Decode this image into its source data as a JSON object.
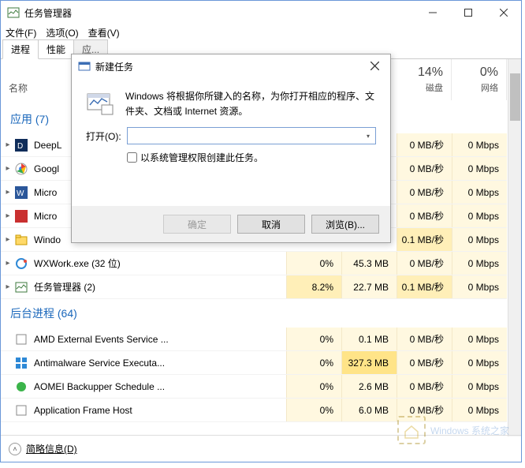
{
  "titlebar": {
    "title": "任务管理器"
  },
  "menubar": {
    "file": "文件(F)",
    "options": "选项(O)",
    "view": "查看(V)"
  },
  "tabs": {
    "t0": "进程",
    "t1": "性能",
    "t2": "应..."
  },
  "columns": {
    "name": "名称",
    "disk_pct": "14%",
    "disk_lbl": "磁盘",
    "net_pct": "0%",
    "net_lbl": "网络"
  },
  "groups": {
    "apps": "应用 (7)",
    "bg": "后台进程 (64)"
  },
  "rows": [
    {
      "name": "DeepL",
      "cpu": "",
      "mem": "",
      "disk": "0 MB/秒",
      "net": "0 Mbps"
    },
    {
      "name": "Googl",
      "cpu": "",
      "mem": "",
      "disk": "0 MB/秒",
      "net": "0 Mbps"
    },
    {
      "name": "Micro",
      "cpu": "",
      "mem": "",
      "disk": "0 MB/秒",
      "net": "0 Mbps"
    },
    {
      "name": "Micro",
      "cpu": "",
      "mem": "",
      "disk": "0 MB/秒",
      "net": "0 Mbps"
    },
    {
      "name": "Windo",
      "cpu": "",
      "mem": "",
      "disk": "0.1 MB/秒",
      "net": "0 Mbps"
    },
    {
      "name": "WXWork.exe (32 位)",
      "cpu": "0%",
      "mem": "45.3 MB",
      "disk": "0 MB/秒",
      "net": "0 Mbps"
    },
    {
      "name": "任务管理器 (2)",
      "cpu": "8.2%",
      "mem": "22.7 MB",
      "disk": "0.1 MB/秒",
      "net": "0 Mbps"
    }
  ],
  "bg_rows": [
    {
      "name": "AMD External Events Service ...",
      "cpu": "0%",
      "mem": "0.1 MB",
      "disk": "0 MB/秒",
      "net": "0 Mbps"
    },
    {
      "name": "Antimalware Service Executa...",
      "cpu": "0%",
      "mem": "327.3 MB",
      "disk": "0 MB/秒",
      "net": "0 Mbps"
    },
    {
      "name": "AOMEI Backupper Schedule ...",
      "cpu": "0%",
      "mem": "2.6 MB",
      "disk": "0 MB/秒",
      "net": "0 Mbps"
    },
    {
      "name": "Application Frame Host",
      "cpu": "0%",
      "mem": "6.0 MB",
      "disk": "0 MB/秒",
      "net": "0 Mbps"
    }
  ],
  "footer": {
    "brief": "简略信息(D)"
  },
  "dialog": {
    "title": "新建任务",
    "desc": "Windows 将根据你所键入的名称，为你打开相应的程序、文件夹、文档或 Internet 资源。",
    "open_label": "打开(O):",
    "input_value": "",
    "checkbox_label": "以系统管理权限创建此任务。",
    "ok": "确定",
    "cancel": "取消",
    "browse": "浏览(B)..."
  },
  "watermark": {
    "text": "Windows 系统之家"
  },
  "icons": {
    "taskmgr_color": "#3c6eb4",
    "run_icon": "#3c6eb4"
  }
}
